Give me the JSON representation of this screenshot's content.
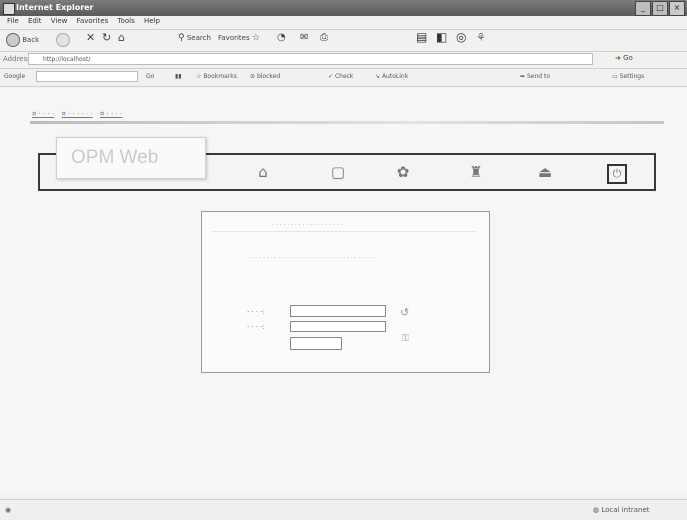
{
  "window": {
    "title": "Internet Explorer",
    "minimize_glyph": "_",
    "maximize_glyph": "□",
    "close_glyph": "×"
  },
  "menu": [
    "File",
    "Edit",
    "View",
    "Favorites",
    "Tools",
    "Help"
  ],
  "toolbar": {
    "back": "Back",
    "search": "Search",
    "favorites": "Favorites"
  },
  "address": {
    "label": "Address",
    "url": "http://localhost/",
    "go": "Go"
  },
  "google_bar": {
    "google": "Google",
    "search_go": "Go",
    "bookmarks": "Bookmarks",
    "blocked": "blocked",
    "check": "Check",
    "autolink": "AutoLink",
    "send_to": "Send to",
    "settings": "Settings"
  },
  "site": {
    "logo": "OPM Web"
  },
  "status": {
    "zone": "Local intranet"
  },
  "icons": [
    "ie-logo-icon",
    "back-arrow-icon",
    "home-icon",
    "document-icon",
    "settings-icon",
    "user-icon",
    "mail-icon",
    "power-icon",
    "refresh-icon",
    "key-icon",
    "globe-icon"
  ]
}
